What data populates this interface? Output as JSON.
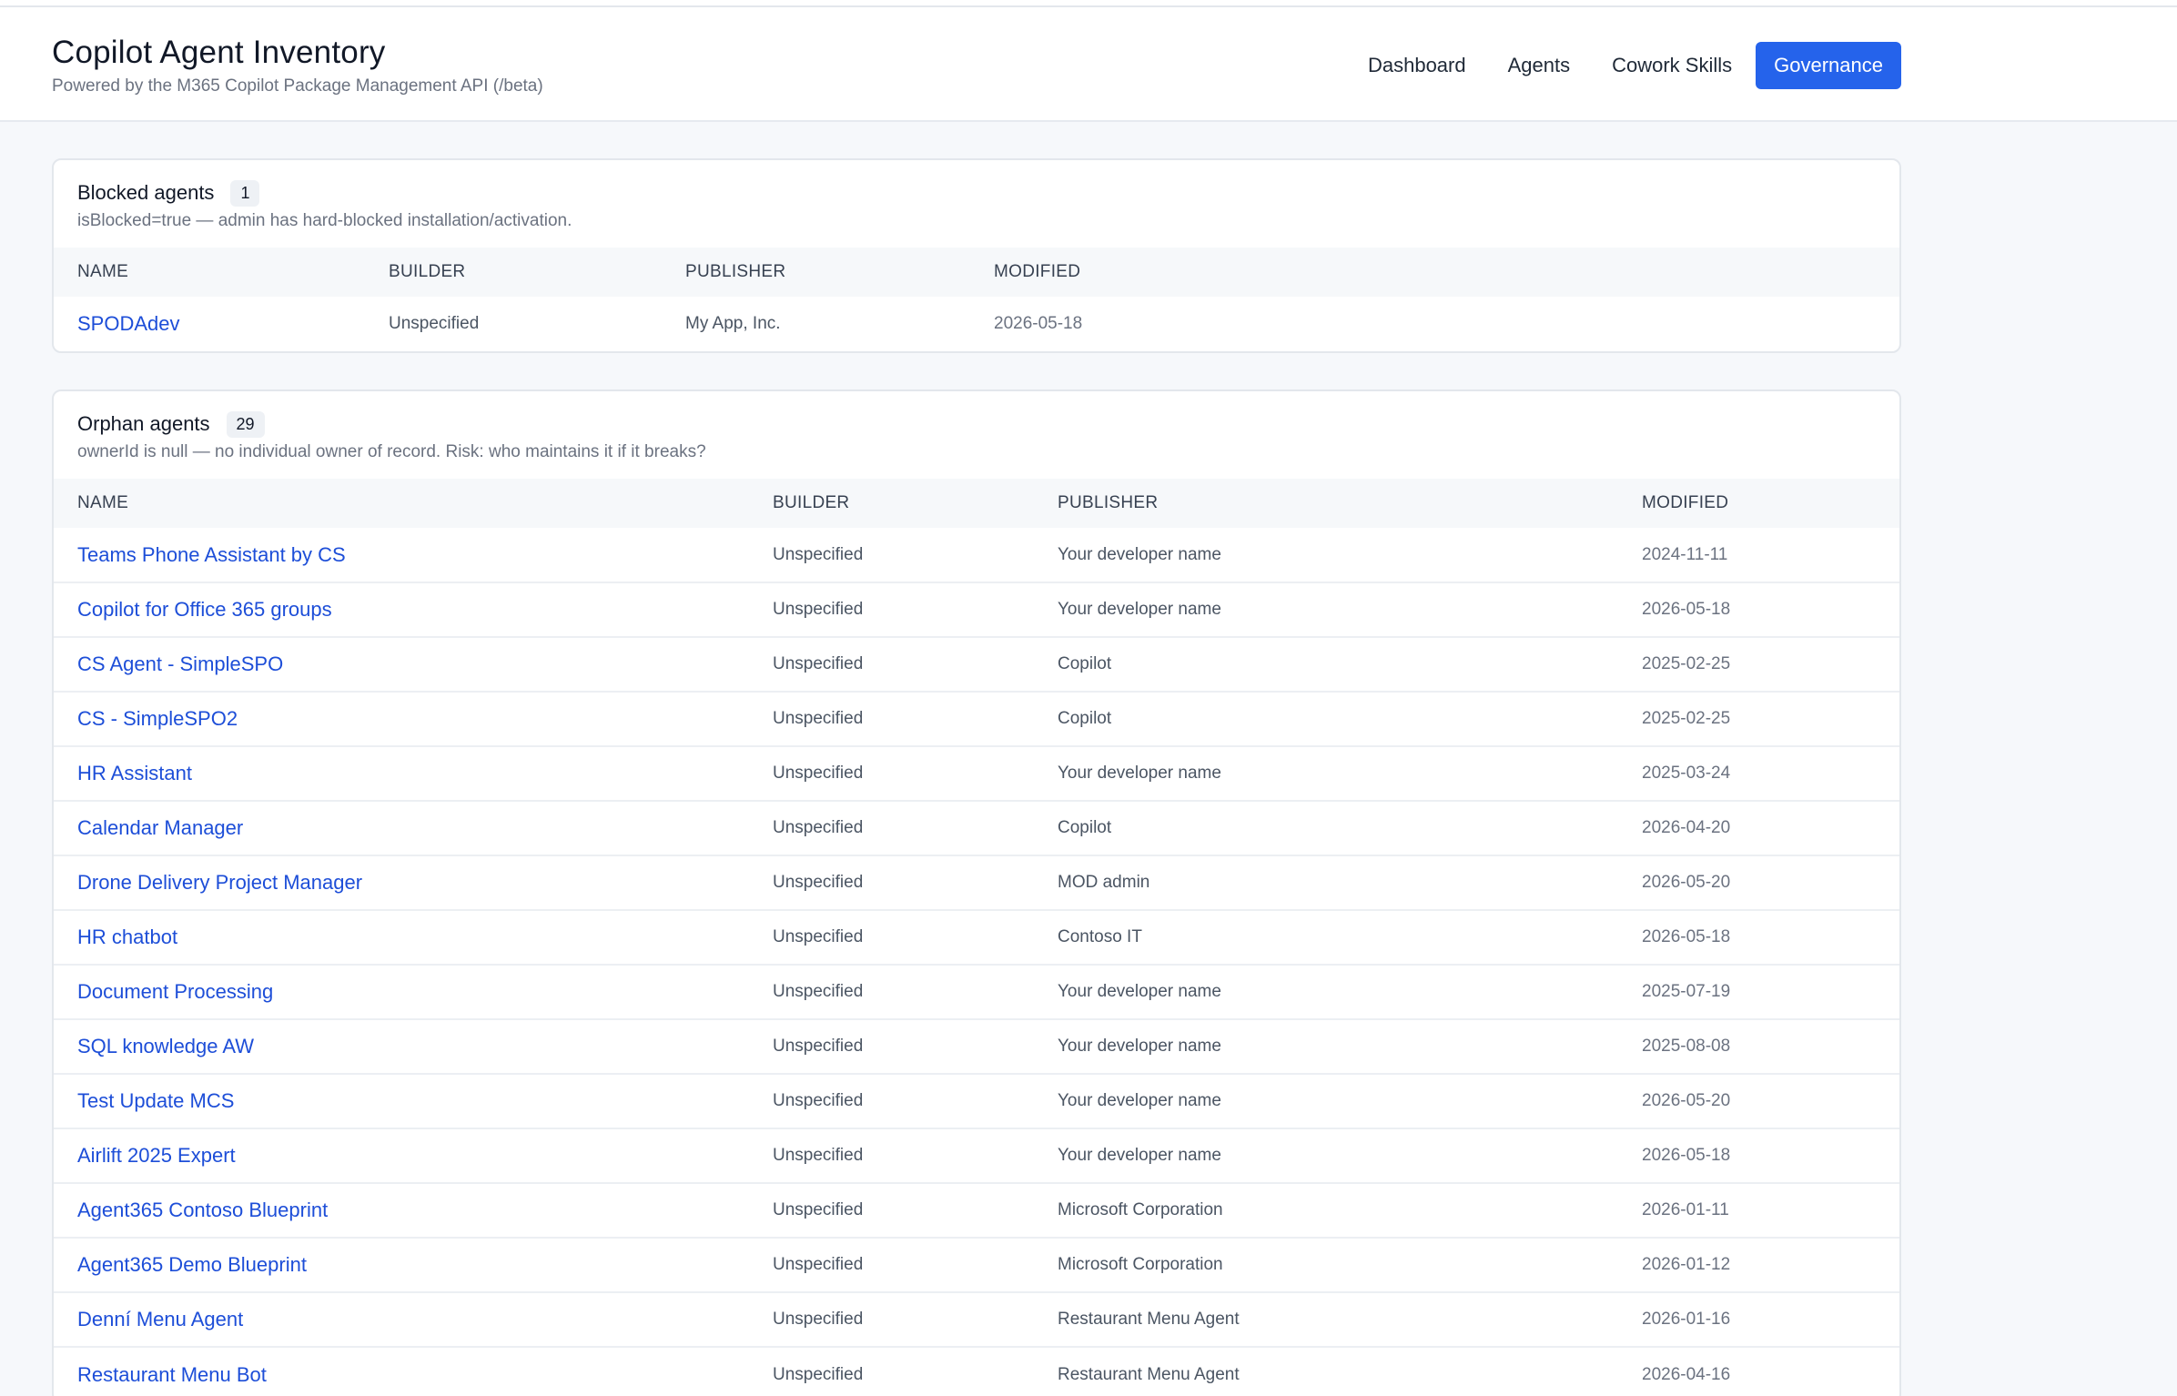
{
  "app": {
    "title": "Copilot Agent Inventory",
    "subtitle": "Powered by the M365 Copilot Package Management API (/beta)"
  },
  "nav": [
    {
      "label": "Dashboard",
      "active": false
    },
    {
      "label": "Agents",
      "active": false
    },
    {
      "label": "Cowork Skills",
      "active": false
    },
    {
      "label": "Governance",
      "active": true
    }
  ],
  "colors": {
    "accent": "#2563eb",
    "link": "#1d4ed8"
  },
  "blocked": {
    "title": "Blocked agents",
    "count": "1",
    "description": "isBlocked=true — admin has hard-blocked installation/activation.",
    "columns": [
      "NAME",
      "BUILDER",
      "PUBLISHER",
      "MODIFIED"
    ],
    "rows": [
      {
        "name": "SPODAdev",
        "builder": "Unspecified",
        "publisher": "My App, Inc.",
        "modified": "2026-05-18"
      }
    ]
  },
  "orphan": {
    "title": "Orphan agents",
    "count": "29",
    "description": "ownerId is null — no individual owner of record. Risk: who maintains it if it breaks?",
    "columns": [
      "NAME",
      "BUILDER",
      "PUBLISHER",
      "MODIFIED"
    ],
    "rows": [
      {
        "name": "Teams Phone Assistant by CS",
        "builder": "Unspecified",
        "publisher": "Your developer name",
        "modified": "2024-11-11"
      },
      {
        "name": "Copilot for Office 365 groups",
        "builder": "Unspecified",
        "publisher": "Your developer name",
        "modified": "2026-05-18"
      },
      {
        "name": "CS Agent - SimpleSPO",
        "builder": "Unspecified",
        "publisher": "Copilot",
        "modified": "2025-02-25"
      },
      {
        "name": "CS - SimpleSPO2",
        "builder": "Unspecified",
        "publisher": "Copilot",
        "modified": "2025-02-25"
      },
      {
        "name": "HR Assistant",
        "builder": "Unspecified",
        "publisher": "Your developer name",
        "modified": "2025-03-24"
      },
      {
        "name": "Calendar Manager",
        "builder": "Unspecified",
        "publisher": "Copilot",
        "modified": "2026-04-20"
      },
      {
        "name": "Drone Delivery Project Manager",
        "builder": "Unspecified",
        "publisher": "MOD admin",
        "modified": "2026-05-20"
      },
      {
        "name": "HR chatbot",
        "builder": "Unspecified",
        "publisher": "Contoso IT",
        "modified": "2026-05-18"
      },
      {
        "name": "Document Processing",
        "builder": "Unspecified",
        "publisher": "Your developer name",
        "modified": "2025-07-19"
      },
      {
        "name": "SQL knowledge AW",
        "builder": "Unspecified",
        "publisher": "Your developer name",
        "modified": "2025-08-08"
      },
      {
        "name": "Test Update MCS",
        "builder": "Unspecified",
        "publisher": "Your developer name",
        "modified": "2026-05-20"
      },
      {
        "name": "Airlift 2025 Expert",
        "builder": "Unspecified",
        "publisher": "Your developer name",
        "modified": "2026-05-18"
      },
      {
        "name": "Agent365 Contoso Blueprint",
        "builder": "Unspecified",
        "publisher": "Microsoft Corporation",
        "modified": "2026-01-11"
      },
      {
        "name": "Agent365 Demo Blueprint",
        "builder": "Unspecified",
        "publisher": "Microsoft Corporation",
        "modified": "2026-01-12"
      },
      {
        "name": "Denní Menu Agent",
        "builder": "Unspecified",
        "publisher": "Restaurant Menu Agent",
        "modified": "2026-01-16"
      },
      {
        "name": "Restaurant Menu Bot",
        "builder": "Unspecified",
        "publisher": "Restaurant Menu Agent",
        "modified": "2026-04-16"
      }
    ]
  }
}
